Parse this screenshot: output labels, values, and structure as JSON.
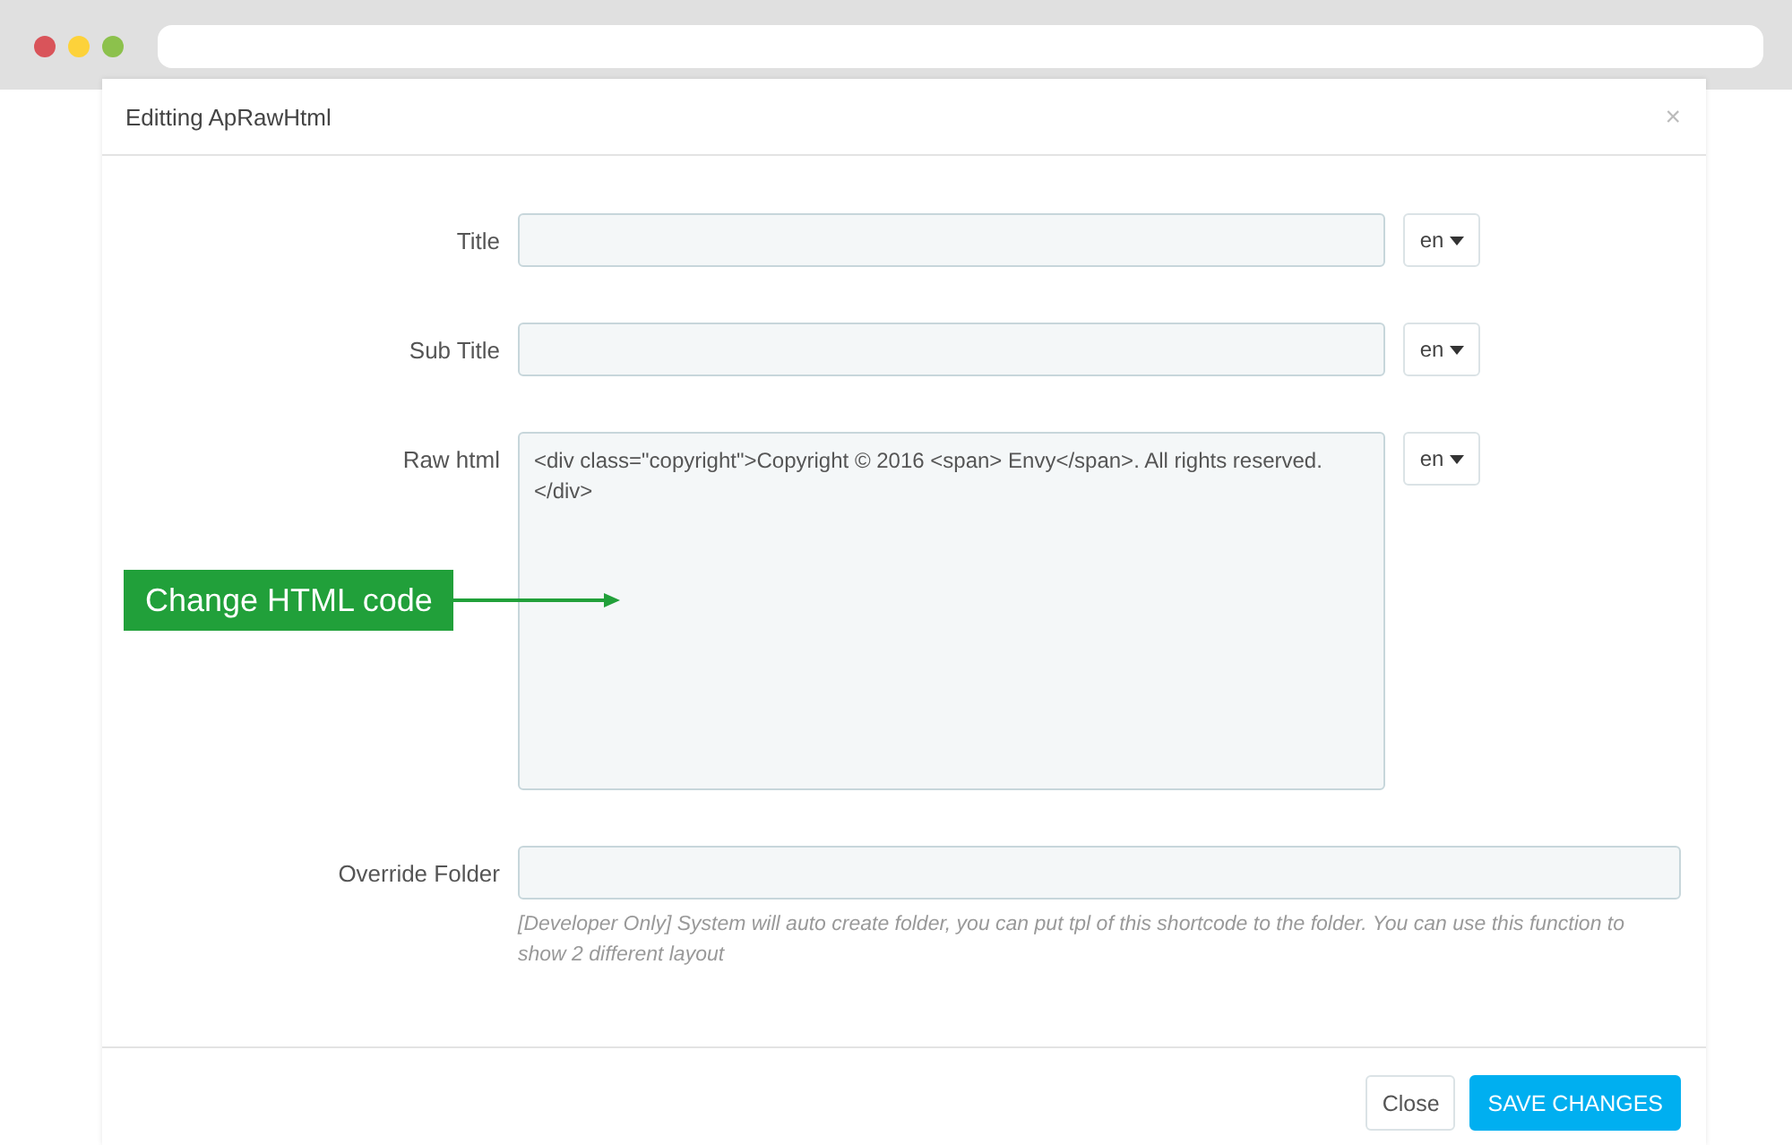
{
  "modal": {
    "title": "Editting ApRawHtml",
    "close_icon": "×"
  },
  "fields": [
    {
      "kind": "input",
      "label": "Title",
      "lang": "en"
    },
    {
      "kind": "input",
      "label": "Sub Title",
      "lang": "en"
    },
    {
      "kind": "textarea",
      "label": "Raw html",
      "value": "<div class=\"copyright\">Copyright © 2016 <span> Envy</span>. All rights reserved.\n</div>",
      "lang": "en"
    },
    {
      "kind": "wide",
      "label": "Override Folder",
      "help": "[Developer Only] System will auto create folder, you can put tpl of this shortcode to the folder. You can use this function to show 2 different layout"
    }
  ],
  "callout": {
    "text": "Change HTML code"
  },
  "buttons": [
    {
      "label": "Close",
      "kind": "default"
    },
    {
      "label": "SAVE CHANGES",
      "kind": "primary"
    }
  ]
}
